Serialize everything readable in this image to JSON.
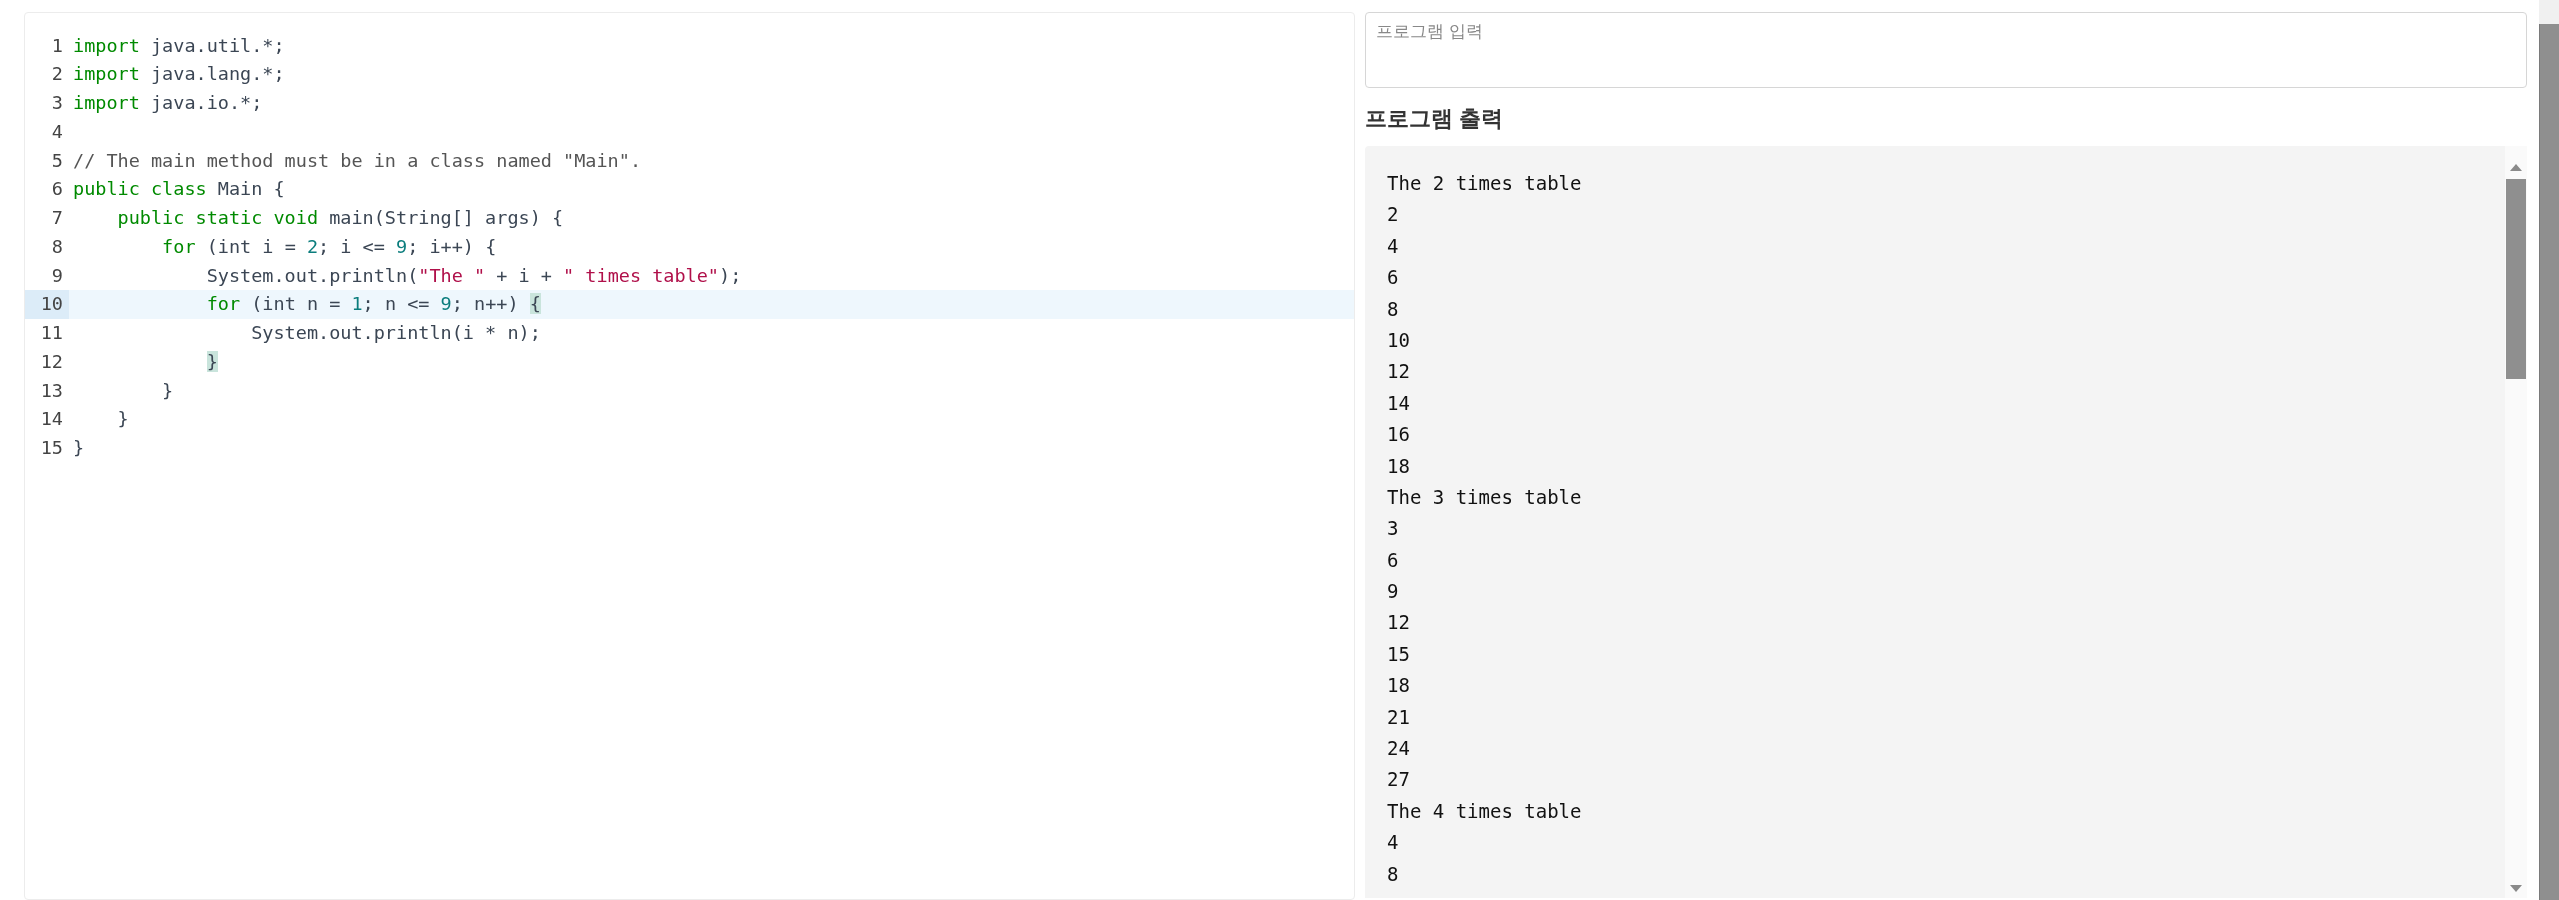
{
  "editor": {
    "lines": [
      {
        "number": "1",
        "active": false,
        "tokens": [
          {
            "kind": "keyword",
            "text": "import"
          },
          {
            "kind": "plain",
            "text": " java.util.*;"
          }
        ]
      },
      {
        "number": "2",
        "active": false,
        "tokens": [
          {
            "kind": "keyword",
            "text": "import"
          },
          {
            "kind": "plain",
            "text": " java.lang.*;"
          }
        ]
      },
      {
        "number": "3",
        "active": false,
        "tokens": [
          {
            "kind": "keyword",
            "text": "import"
          },
          {
            "kind": "plain",
            "text": " java.io.*;"
          }
        ]
      },
      {
        "number": "4",
        "active": false
      },
      {
        "number": "5",
        "active": false,
        "tokens": [
          {
            "kind": "comment",
            "text": "// The main method must be in a class named \"Main\"."
          }
        ]
      },
      {
        "number": "6",
        "active": false,
        "tokens": [
          {
            "kind": "keyword",
            "text": "public class"
          },
          {
            "kind": "plain",
            "text": " Main {"
          }
        ]
      },
      {
        "number": "7",
        "active": false,
        "tokens": [
          {
            "kind": "keyword",
            "text": "    public static void"
          },
          {
            "kind": "plain",
            "text": " main(String[] args) {"
          }
        ]
      },
      {
        "number": "8",
        "active": false,
        "tokens": [
          {
            "kind": "keyword",
            "text": "        for"
          },
          {
            "kind": "plain",
            "text": " (int i = "
          },
          {
            "kind": "number",
            "text": "2"
          },
          {
            "kind": "plain",
            "text": "; i <= "
          },
          {
            "kind": "number",
            "text": "9"
          },
          {
            "kind": "plain",
            "text": "; i++) {"
          }
        ]
      },
      {
        "number": "9",
        "active": false,
        "tokens": [
          {
            "kind": "plain",
            "text": "            System.out.println("
          },
          {
            "kind": "string",
            "text": "\"The \""
          },
          {
            "kind": "plain",
            "text": " + i + "
          },
          {
            "kind": "string",
            "text": "\" times table\""
          },
          {
            "kind": "plain",
            "text": ");"
          }
        ]
      },
      {
        "number": "10",
        "active": true,
        "tokens": [
          {
            "kind": "keyword",
            "text": "            for"
          },
          {
            "kind": "plain",
            "text": " (int n = "
          },
          {
            "kind": "number",
            "text": "1"
          },
          {
            "kind": "plain",
            "text": "; n <= "
          },
          {
            "kind": "number",
            "text": "9"
          },
          {
            "kind": "plain",
            "text": "; n++) "
          },
          {
            "kind": "match",
            "text": "{"
          }
        ]
      },
      {
        "number": "11",
        "active": false,
        "tokens": [
          {
            "kind": "plain",
            "text": "                System.out.println(i * n);"
          }
        ]
      },
      {
        "number": "12",
        "active": false,
        "tokens": [
          {
            "kind": "match",
            "text": "            }"
          }
        ]
      },
      {
        "number": "13",
        "active": false,
        "tokens": [
          {
            "kind": "plain",
            "text": "        }"
          }
        ]
      },
      {
        "number": "14",
        "active": false,
        "tokens": [
          {
            "kind": "plain",
            "text": "    }"
          }
        ]
      },
      {
        "number": "15",
        "active": false,
        "tokens": [
          {
            "kind": "plain",
            "text": "}"
          }
        ]
      }
    ]
  },
  "input": {
    "placeholder": "프로그램 입력"
  },
  "output": {
    "heading": "프로그램 출력",
    "lines": [
      "The 2 times table",
      "2",
      "4",
      "6",
      "8",
      "10",
      "12",
      "14",
      "16",
      "18",
      "The 3 times table",
      "3",
      "6",
      "9",
      "12",
      "15",
      "18",
      "21",
      "24",
      "27",
      "The 4 times table",
      "4",
      "8"
    ]
  }
}
